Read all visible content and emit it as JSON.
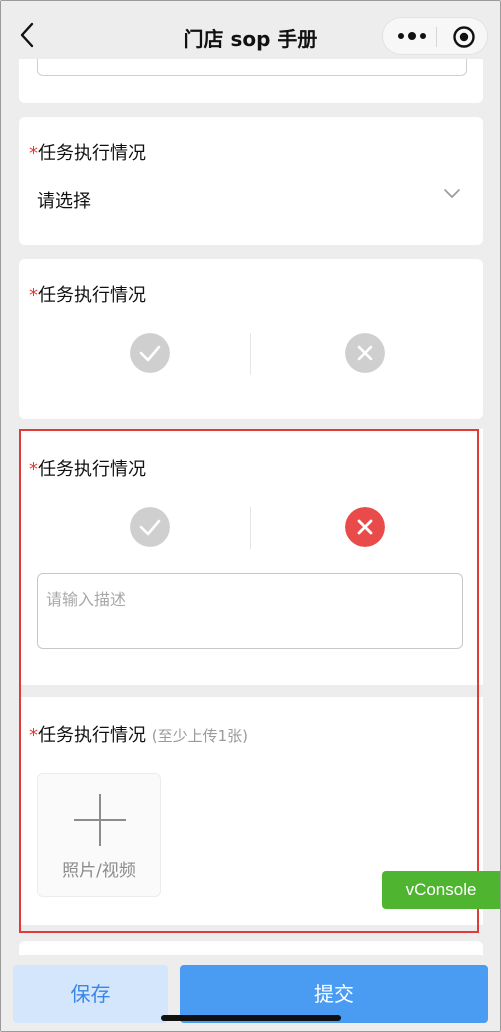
{
  "nav": {
    "title": "门店 sop 手册",
    "back_icon": "chevron-left-icon",
    "more_icon": "more-dots-icon",
    "close_icon": "target-circle-icon"
  },
  "form": {
    "sections": [
      {
        "required_mark": "*",
        "label": "任务执行情况",
        "type": "select",
        "value": "请选择"
      },
      {
        "required_mark": "*",
        "label": "任务执行情况",
        "type": "check-cross",
        "selected": "none"
      },
      {
        "required_mark": "*",
        "label": "任务执行情况",
        "type": "check-cross",
        "selected": "cross",
        "description_placeholder": "请输入描述"
      },
      {
        "required_mark": "*",
        "label": "任务执行情况",
        "hint": "(至少上传1张)",
        "type": "upload",
        "upload_label": "照片/视频"
      }
    ]
  },
  "vconsole": {
    "label": "vConsole"
  },
  "footer": {
    "save_label": "保存",
    "submit_label": "提交"
  },
  "colors": {
    "accent": "#4a9bf2",
    "required": "#e53935",
    "cross_active": "#e94b4b",
    "inactive_icon": "#cfcfcf",
    "highlight_border": "#e03a3a",
    "vconsole": "#4fb530"
  }
}
